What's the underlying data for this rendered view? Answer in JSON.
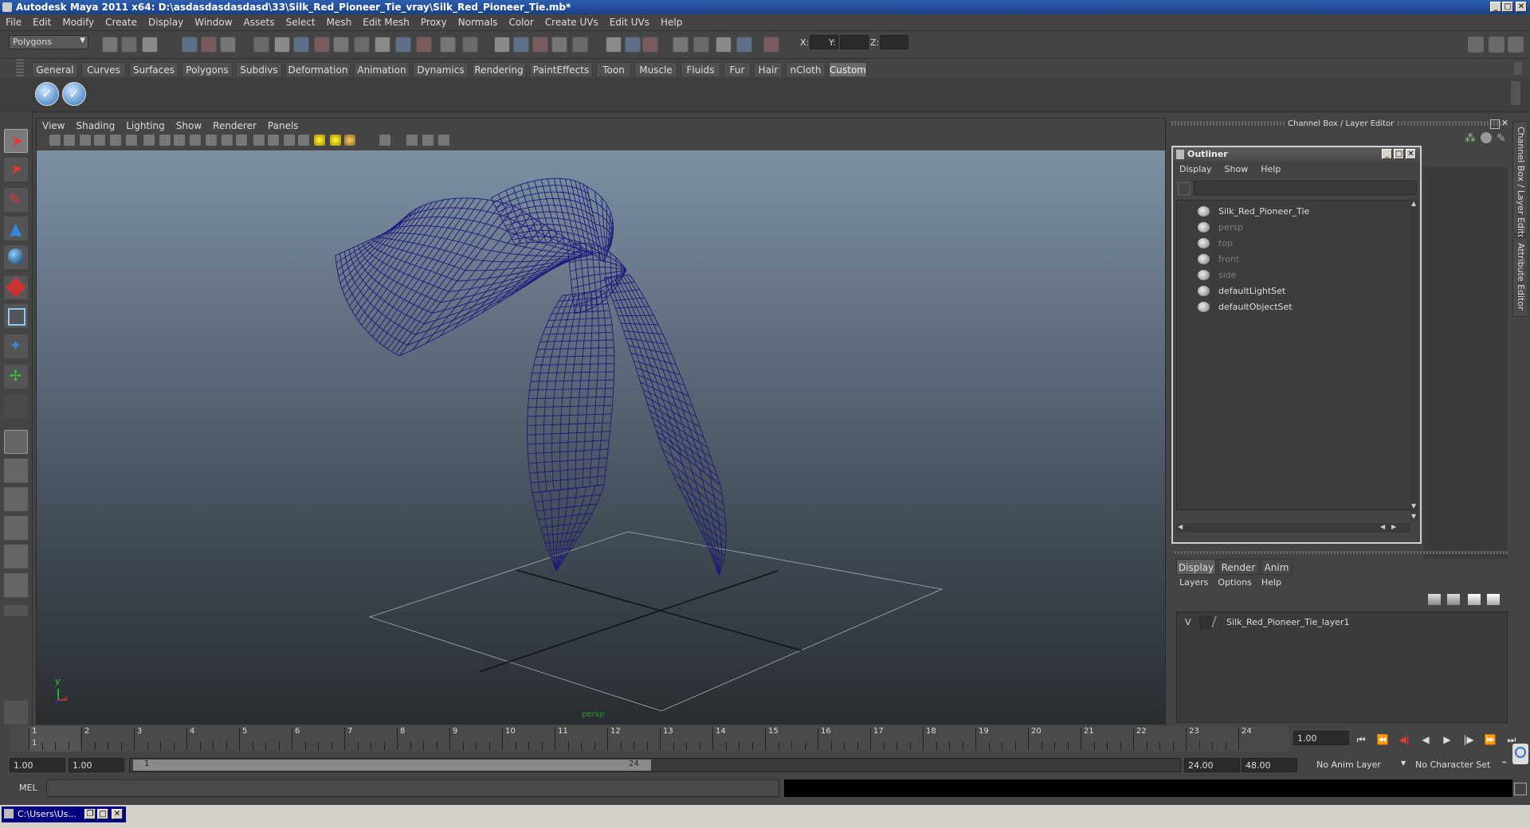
{
  "window": {
    "title": "Autodesk Maya 2011 x64: D:\\asdasdasdasdasd\\33\\Silk_Red_Pioneer_Tie_vray\\Silk_Red_Pioneer_Tie.mb*"
  },
  "menubar": [
    "File",
    "Edit",
    "Modify",
    "Create",
    "Display",
    "Window",
    "Assets",
    "Select",
    "Mesh",
    "Edit Mesh",
    "Proxy",
    "Normals",
    "Color",
    "Create UVs",
    "Edit UVs",
    "Help"
  ],
  "statusline": {
    "mode": "Polygons",
    "x_label": "X:",
    "y_label": "Y:",
    "z_label": "Z:"
  },
  "shelf_tabs": [
    "General",
    "Curves",
    "Surfaces",
    "Polygons",
    "Subdivs",
    "Deformation",
    "Animation",
    "Dynamics",
    "Rendering",
    "PaintEffects",
    "Toon",
    "Muscle",
    "Fluids",
    "Fur",
    "Hair",
    "nCloth",
    "Custom"
  ],
  "shelf_active": "Custom",
  "viewport": {
    "menu": [
      "View",
      "Shading",
      "Lighting",
      "Show",
      "Renderer",
      "Panels"
    ],
    "axis_y": "y",
    "axis_x": "x",
    "camera_label": "persp"
  },
  "channel_box_title": "Channel Box / Layer Editor",
  "outliner": {
    "title": "Outliner",
    "menu": [
      "Display",
      "Show",
      "Help"
    ],
    "items": [
      {
        "label": "Silk_Red_Pioneer_Tie",
        "dim": false,
        "icon": "mesh-icon"
      },
      {
        "label": "persp",
        "dim": true,
        "icon": "camera-icon"
      },
      {
        "label": "top",
        "dim": true,
        "icon": "camera-icon"
      },
      {
        "label": "front",
        "dim": true,
        "icon": "camera-icon"
      },
      {
        "label": "side",
        "dim": true,
        "icon": "camera-icon"
      },
      {
        "label": "defaultLightSet",
        "dim": false,
        "icon": "set-icon"
      },
      {
        "label": "defaultObjectSet",
        "dim": false,
        "icon": "set-icon"
      }
    ]
  },
  "layer_editor": {
    "tabs": [
      "Display",
      "Render",
      "Anim"
    ],
    "active_tab": "Display",
    "menu": [
      "Layers",
      "Options",
      "Help"
    ],
    "layers": [
      {
        "visible": "V",
        "name": "Silk_Red_Pioneer_Tie_layer1"
      }
    ]
  },
  "side_tabs": [
    "Channel Box / Layer Editor",
    "Attribute Editor"
  ],
  "timeline": {
    "ticks": [
      "1",
      "2",
      "3",
      "4",
      "5",
      "6",
      "7",
      "8",
      "9",
      "10",
      "11",
      "12",
      "13",
      "14",
      "15",
      "16",
      "17",
      "18",
      "19",
      "20",
      "21",
      "22",
      "23",
      "24"
    ],
    "current_marker": "1",
    "current_frame": "1.00"
  },
  "range": {
    "start": "1.00",
    "playback_start": "1.00",
    "slider_start": "1",
    "slider_end": "24",
    "playback_end": "24.00",
    "end": "48.00",
    "anim_layer": "No Anim Layer",
    "character_set": "No Character Set"
  },
  "cmdline": {
    "label": "MEL"
  },
  "taskbar": {
    "item": "C:\\Users\\Us..."
  }
}
